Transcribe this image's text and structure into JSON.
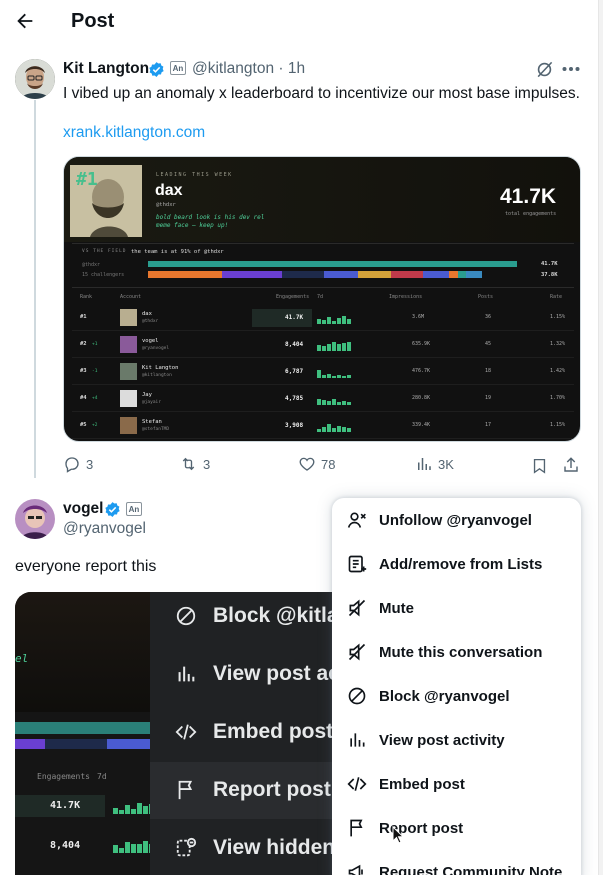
{
  "header": {
    "title": "Post"
  },
  "post": {
    "author_name": "Kit Langton",
    "badge": "An",
    "handle_time": "@kitlangton · 1h",
    "text": "I vibed up an anomaly x leaderboard to incentivize our most base impulses.",
    "link": "xrank.kitlangton.com",
    "stats": {
      "replies": "3",
      "reposts": "3",
      "likes": "78",
      "views": "3K"
    }
  },
  "card": {
    "leading_label": "LEADING THIS WEEK",
    "rank_badge": "#1",
    "leader_name": "dax",
    "leader_handle": "@thdxr",
    "leader_quote_1": "bold beard look is his dev rel",
    "leader_quote_2": "meme face — keep up!",
    "total_value": "41.7K",
    "total_label": "total engagements",
    "vs_label": "VS THE FIELD",
    "vs_text": "the team is at 91% of @thdxr",
    "bar1_label": "@thdxr",
    "bar1_value": "41.7K",
    "bar2_label": "15 challengers",
    "bar2_value": "37.8K",
    "columns": [
      "Rank",
      "Account",
      "Engagements",
      "7d",
      "Impressions",
      "Posts",
      "Rate"
    ],
    "rows": [
      {
        "rank": "#1",
        "delta": "",
        "name": "dax",
        "handle": "@thdxr",
        "eng": "41.7K",
        "imp": "3.6M",
        "posts": "36",
        "rate": "1.15%"
      },
      {
        "rank": "#2",
        "delta": "+1",
        "name": "vogel",
        "handle": "@ryanvogel",
        "eng": "8,404",
        "imp": "635.9K",
        "posts": "45",
        "rate": "1.32%"
      },
      {
        "rank": "#3",
        "delta": "-1",
        "name": "Kit Langton",
        "handle": "@kitlangton",
        "eng": "6,787",
        "imp": "476.7K",
        "posts": "18",
        "rate": "1.42%"
      },
      {
        "rank": "#4",
        "delta": "+4",
        "name": "Jay",
        "handle": "@jayair",
        "eng": "4,785",
        "imp": "280.8K",
        "posts": "19",
        "rate": "1.70%"
      },
      {
        "rank": "#5",
        "delta": "+2",
        "name": "Stefan",
        "handle": "@stefanTMD",
        "eng": "3,908",
        "imp": "339.4K",
        "posts": "17",
        "rate": "1.15%"
      }
    ]
  },
  "reply": {
    "author_name": "vogel",
    "badge": "An",
    "handle": "@ryanvogel",
    "text": "everyone report this"
  },
  "reply_image": {
    "side_text": "el",
    "eng_label": "Engagements",
    "d7_label": "7d",
    "val1": "41.7K",
    "val2": "8,404",
    "items": [
      "Block @kitlan",
      "View post ac",
      "Embed post",
      "Report post",
      "View hidden"
    ]
  },
  "menu": {
    "items": [
      {
        "label": "Unfollow @ryanvogel",
        "icon": "unfollow-icon"
      },
      {
        "label": "Add/remove from Lists",
        "icon": "list-icon"
      },
      {
        "label": "Mute",
        "icon": "mute-icon"
      },
      {
        "label": "Mute this conversation",
        "icon": "mute-conversation-icon"
      },
      {
        "label": "Block @ryanvogel",
        "icon": "block-icon"
      },
      {
        "label": "View post activity",
        "icon": "analytics-icon"
      },
      {
        "label": "Embed post",
        "icon": "embed-icon"
      },
      {
        "label": "Report post",
        "icon": "flag-icon"
      },
      {
        "label": "Request Community Note",
        "icon": "megaphone-icon"
      }
    ]
  },
  "colors": {
    "accent": "#1d9bf0",
    "bar_teal": "#2a9d8f",
    "bar_purple": "#6a3fd1",
    "bar_orange": "#e8772e"
  }
}
